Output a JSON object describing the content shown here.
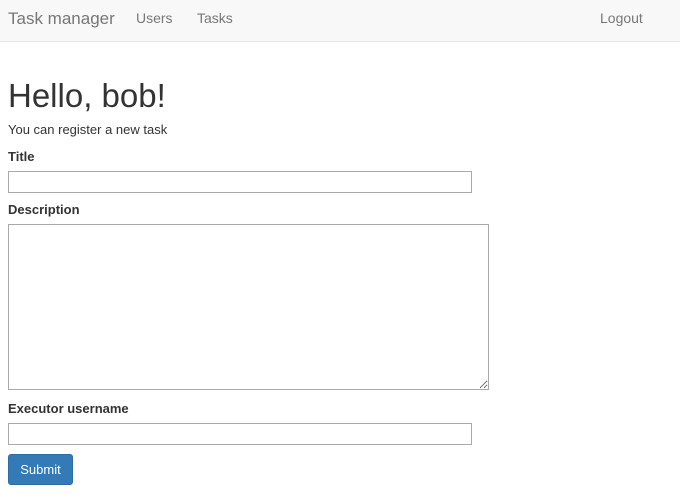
{
  "navbar": {
    "brand": "Task manager",
    "links": [
      {
        "label": "Users"
      },
      {
        "label": "Tasks"
      }
    ],
    "logout_label": "Logout"
  },
  "main": {
    "greeting": "Hello, bob!",
    "subtitle": "You can register a new task",
    "form": {
      "title_label": "Title",
      "title_value": "",
      "description_label": "Description",
      "description_value": "",
      "executor_label": "Executor username",
      "executor_value": "",
      "submit_label": "Submit"
    }
  },
  "colors": {
    "navbar_bg": "#f8f8f8",
    "navbar_text": "#777777",
    "primary_button": "#337ab7"
  }
}
